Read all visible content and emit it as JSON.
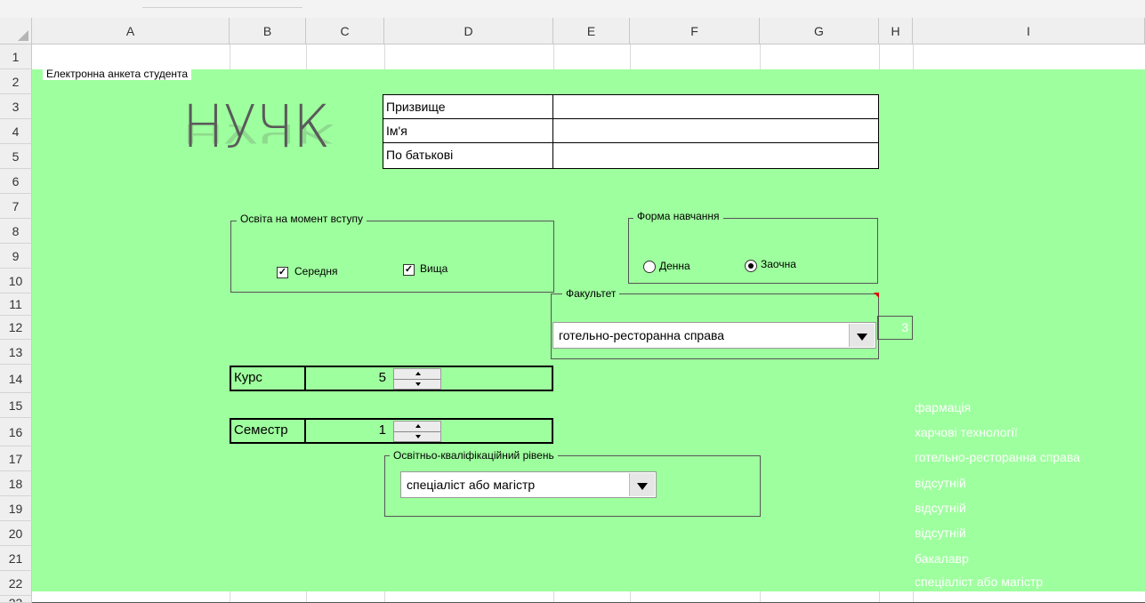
{
  "columns": [
    "A",
    "B",
    "C",
    "D",
    "E",
    "F",
    "G",
    "H",
    "I"
  ],
  "rows": [
    "1",
    "2",
    "3",
    "4",
    "5",
    "6",
    "7",
    "8",
    "9",
    "10",
    "11",
    "12",
    "13",
    "14",
    "15",
    "16",
    "17",
    "18",
    "19",
    "20",
    "21",
    "22",
    "23"
  ],
  "form": {
    "title": "Електронна анкета студента",
    "logo": "НУЧК",
    "name_fields": [
      {
        "label": "Призвище",
        "value": ""
      },
      {
        "label": "Ім'я",
        "value": ""
      },
      {
        "label": "По батькові",
        "value": ""
      }
    ],
    "education": {
      "title": "Освіта на момент вступу",
      "options": [
        {
          "label": "Середня",
          "checked": true
        },
        {
          "label": "Вища",
          "checked": true
        }
      ]
    },
    "study_form": {
      "title": "Форма навчання",
      "options": [
        {
          "label": "Денна",
          "selected": false
        },
        {
          "label": "Заочна",
          "selected": true
        }
      ]
    },
    "faculty": {
      "title": "Факультет",
      "selected": "готельно-ресторанна справа",
      "index": "3"
    },
    "course": {
      "label": "Курс",
      "value": "5"
    },
    "semester": {
      "label": "Семестр",
      "value": "1"
    },
    "qualification": {
      "title": "Освітньо-кваліфікаційний рівень",
      "selected": "спеціаліст або магістр"
    },
    "source_list": [
      "фармація",
      "харчові технології",
      "готельно-ресторанна справа",
      "відсутній",
      "відсутній",
      "відсутній",
      "бакалавр",
      "спеціаліст або магістр"
    ]
  },
  "colors": {
    "form_background": "#9eff9e",
    "header_background": "#efefef",
    "list_text": "#ffffff"
  }
}
